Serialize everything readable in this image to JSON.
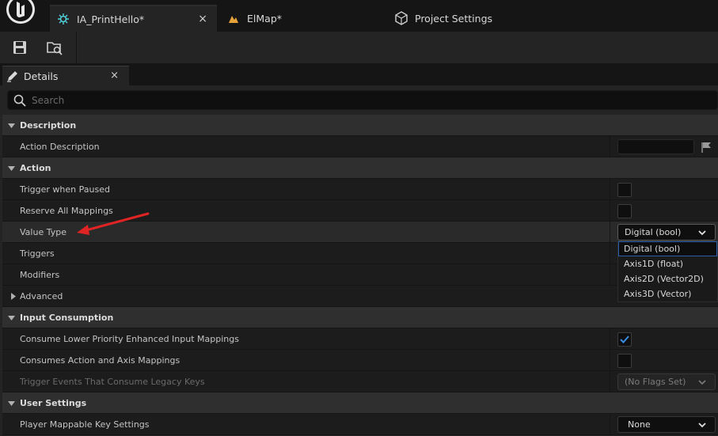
{
  "tabs": [
    {
      "label": "IA_PrintHello*",
      "close": "×",
      "icon": "input-action-icon"
    },
    {
      "label": "ElMap*",
      "icon": "level-map-icon"
    },
    {
      "label": "Project Settings",
      "icon": "settings-cubes-icon"
    }
  ],
  "toolbar": {
    "save_icon": "save-icon",
    "browse_icon": "browse-folder-icon"
  },
  "details": {
    "title": "Details",
    "close": "×"
  },
  "search": {
    "placeholder": "Search"
  },
  "sections": {
    "description": "Description",
    "action": "Action",
    "advanced": "Advanced",
    "input_consumption": "Input Consumption",
    "user_settings": "User Settings"
  },
  "props": {
    "action_description": "Action Description",
    "trigger_when_paused": "Trigger when Paused",
    "reserve_all_mappings": "Reserve All Mappings",
    "value_type": "Value Type",
    "triggers": "Triggers",
    "modifiers": "Modifiers",
    "consume_lower_priority": "Consume Lower Priority Enhanced Input Mappings",
    "consumes_action_axis": "Consumes Action and Axis Mappings",
    "trigger_events_legacy": "Trigger Events That Consume Legacy Keys",
    "player_mappable": "Player Mappable Key Settings"
  },
  "values": {
    "value_type_selected": "Digital (bool)",
    "trigger_events_value": "(No Flags Set)",
    "player_mappable_value": "None",
    "consume_lower_priority_checked": true
  },
  "value_type_options": [
    "Digital (bool)",
    "Axis1D (float)",
    "Axis2D (Vector2D)",
    "Axis3D (Vector)"
  ],
  "colors": {
    "accent": "#2a5fb0",
    "annotation_arrow": "#e02424",
    "checkmark": "#3a8ee6"
  }
}
